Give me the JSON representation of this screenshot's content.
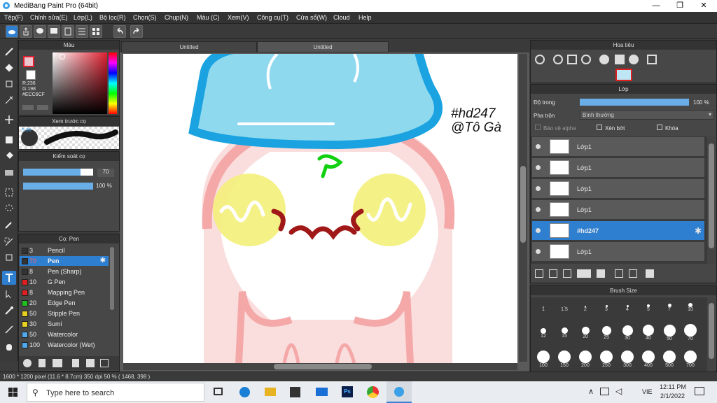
{
  "window": {
    "title": "MediBang Paint Pro (64bit)",
    "min": "—",
    "max": "❐",
    "close": "✕"
  },
  "menu": [
    "Tệp(F)",
    "Chỉnh sửa(E)",
    "Lớp(L)",
    "Bộ lọc(R)",
    "Chọn(S)",
    "Chụp(N)",
    "Màu (C)",
    "Xem(V)",
    "Công cụ(T)",
    "Cửa sổ(W)",
    "Cloud",
    "Help"
  ],
  "tabs": [
    "Untitled",
    "Untitled"
  ],
  "color_panel": {
    "title": "Màu",
    "r": "R:236",
    "g": "G:198",
    "hex": "#ECC6CF",
    "fg": "#ECC6CF",
    "bg": "#ffffff"
  },
  "preview_panel": {
    "title": "Xem trước cọ",
    "size": "5.00"
  },
  "brush_control": {
    "title": "Kiểm soát cọ",
    "size": "70",
    "opacity": "100 %"
  },
  "brush_panel": {
    "title": "Cọ: Pen",
    "items": [
      {
        "n": "3",
        "name": "Pencil",
        "color": "#333333"
      },
      {
        "n": "70",
        "name": "Pen",
        "color": "#333333"
      },
      {
        "n": "8",
        "name": "Pen (Sharp)",
        "color": "#333333"
      },
      {
        "n": "10",
        "name": "G Pen",
        "color": "#e02020"
      },
      {
        "n": "8",
        "name": "Mapping Pen",
        "color": "#e02020"
      },
      {
        "n": "20",
        "name": "Edge Pen",
        "color": "#20c020"
      },
      {
        "n": "50",
        "name": "Stipple Pen",
        "color": "#e6d020"
      },
      {
        "n": "30",
        "name": "Sumi",
        "color": "#e6d020"
      },
      {
        "n": "50",
        "name": "Watercolor",
        "color": "#50a8ee"
      },
      {
        "n": "100",
        "name": "Watercolor (Wet)",
        "color": "#50a8ee"
      }
    ]
  },
  "canvas_text": {
    "line1": "#hd247",
    "line2": "@Tô Gà"
  },
  "nav_panel": {
    "title": "Hoa tiêu"
  },
  "layer_panel": {
    "title": "Lớp",
    "opacity_label": "Độ trong",
    "opacity_value": "100 %",
    "blend_label": "Pha trộn",
    "blend_value": "Bình thường",
    "protect_alpha": "Bảo vệ alpha",
    "clip": "Xén bớt",
    "lock": "Khóa",
    "layers": [
      "Lớp1",
      "Lớp1",
      "Lớp1",
      "Lớp1",
      "#hd247",
      "Lớp1"
    ]
  },
  "brush_size_panel": {
    "title": "Brush Size",
    "row1": [
      "1",
      "1.5",
      "2",
      "3",
      "4",
      "5",
      "7",
      "10"
    ],
    "row2": [
      "12",
      "15",
      "20",
      "25",
      "30",
      "40",
      "50",
      "70"
    ],
    "row3": [
      "100",
      "150",
      "200",
      "250",
      "300",
      "400",
      "500",
      "700"
    ]
  },
  "status": {
    "text": "1600 * 1200 pixel   (11.6 * 8.7cm)   350 dpi   50 %   ( 1468, 398 )"
  },
  "taskbar": {
    "search_placeholder": "Type here to search",
    "lang": "VIE",
    "time": "12:11 PM",
    "date": "2/1/2022"
  }
}
